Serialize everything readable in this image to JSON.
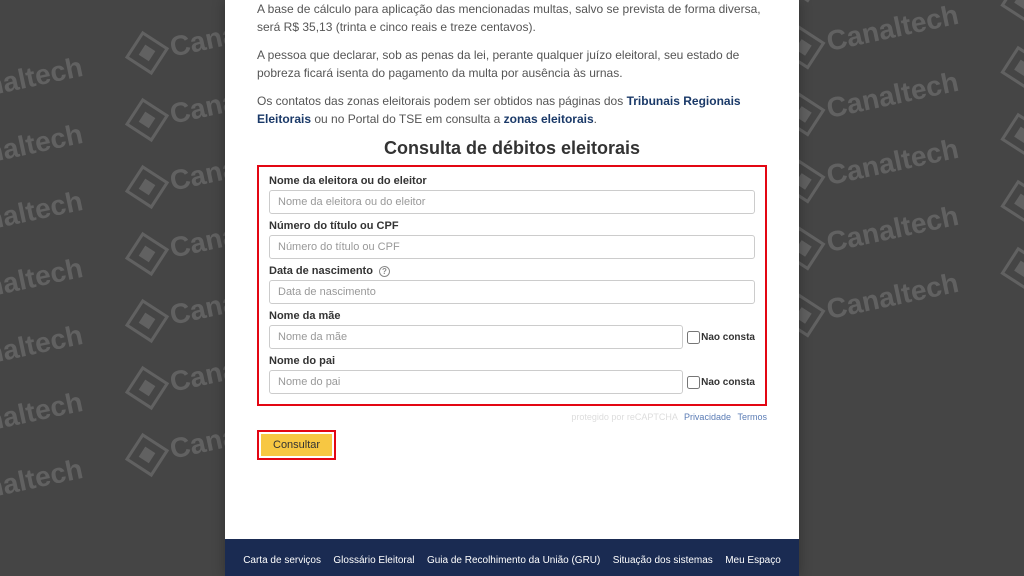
{
  "watermark": {
    "brand": "Canaltech"
  },
  "intro": {
    "p1": "A base de cálculo para aplicação das mencionadas multas, salvo se prevista de forma diversa, será R$ 35,13 (trinta e cinco reais e treze centavos).",
    "p2": "A pessoa que declarar, sob as penas da lei, perante qualquer juízo eleitoral, seu estado de pobreza ficará isenta do pagamento da multa por ausência às urnas.",
    "p3_prefix": "Os contatos das zonas eleitorais podem ser obtidos nas páginas dos ",
    "p3_link1": "Tribunais Regionais Eleitorais",
    "p3_mid": " ou no Portal do TSE em ",
    "p3_link2_prefix": "consulta a ",
    "p3_link2": "zonas eleitorais",
    "p3_suffix": "."
  },
  "form": {
    "title": "Consulta de débitos eleitorais",
    "fields": {
      "nome": {
        "label": "Nome da eleitora ou do eleitor",
        "placeholder": "Nome da eleitora ou do eleitor"
      },
      "titulo": {
        "label": "Número do título ou CPF",
        "placeholder": "Número do título ou CPF"
      },
      "nascimento": {
        "label": "Data de nascimento",
        "placeholder": "Data de nascimento"
      },
      "mae": {
        "label": "Nome da mãe",
        "placeholder": "Nome da mãe",
        "nao_consta": "Nao consta"
      },
      "pai": {
        "label": "Nome do pai",
        "placeholder": "Nome do pai",
        "nao_consta": "Nao consta"
      }
    },
    "recaptcha": {
      "protected": "protegido por reCAPTCHA",
      "privacy": "Privacidade",
      "terms": "Termos"
    },
    "submit": "Consultar"
  },
  "footer": {
    "links": {
      "carta": "Carta de serviços",
      "glossario": "Glossário Eleitoral",
      "gru": "Guia de Recolhimento da União (GRU)",
      "situacao": "Situação dos sistemas",
      "espaco": "Meu Espaço"
    }
  }
}
